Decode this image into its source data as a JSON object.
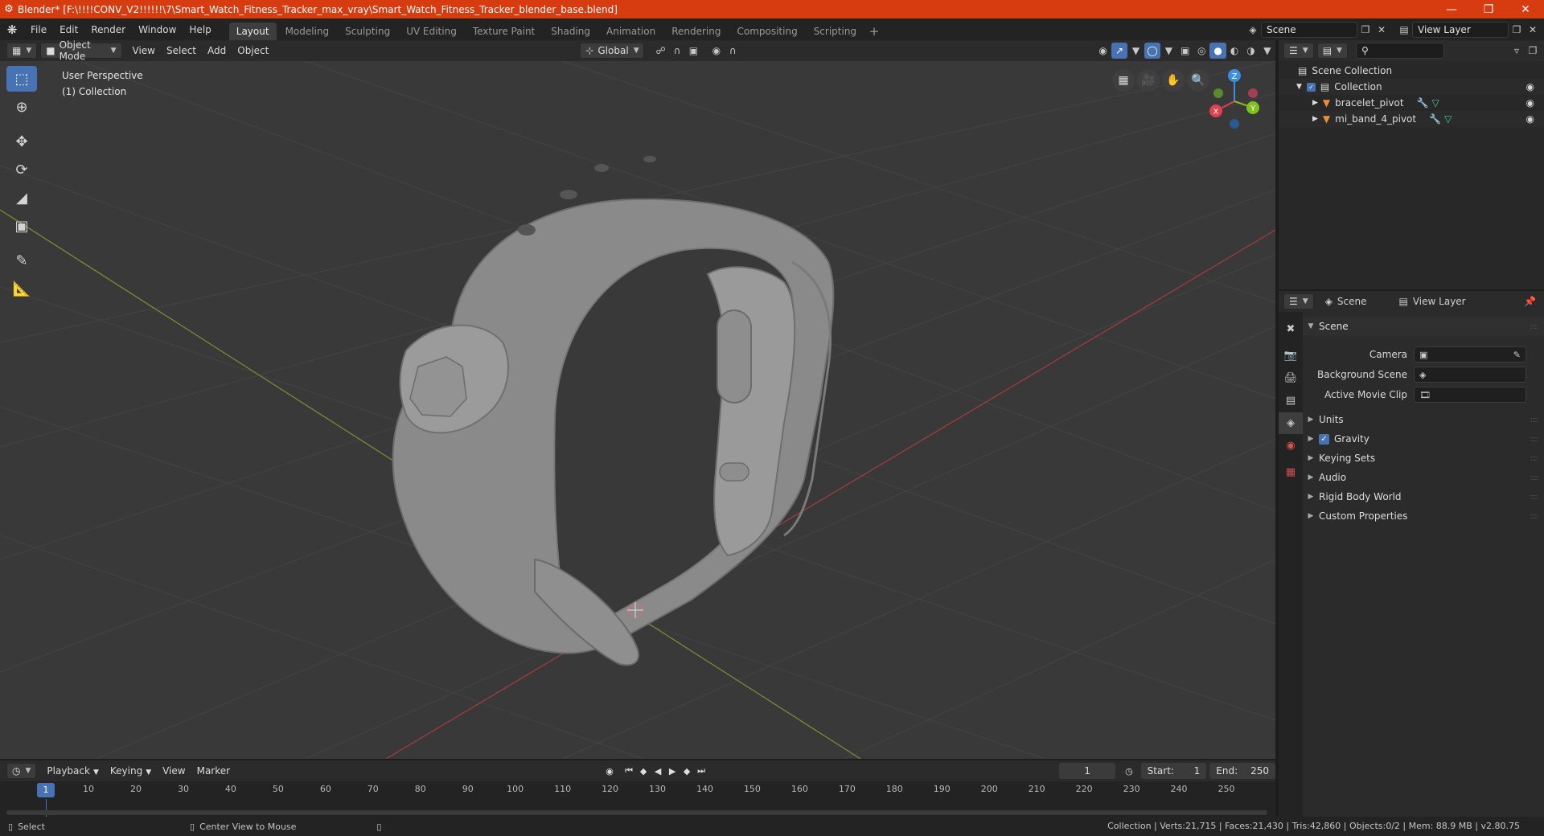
{
  "window": {
    "title": "Blender* [F:\\!!!!CONV_V2!!!!!!\\7\\Smart_Watch_Fitness_Tracker_max_vray\\Smart_Watch_Fitness_Tracker_blender_base.blend]",
    "minimize": "—",
    "maximize": "❐",
    "close": "✕"
  },
  "menu": {
    "file": "File",
    "edit": "Edit",
    "render": "Render",
    "window": "Window",
    "help": "Help"
  },
  "workspaces": [
    "Layout",
    "Modeling",
    "Sculpting",
    "UV Editing",
    "Texture Paint",
    "Shading",
    "Animation",
    "Rendering",
    "Compositing",
    "Scripting"
  ],
  "active_workspace": "Layout",
  "scene_selector": {
    "value": "Scene"
  },
  "view_layer_selector": {
    "value": "View Layer"
  },
  "viewport_header": {
    "mode": "Object Mode",
    "view": "View",
    "select": "Select",
    "add": "Add",
    "object": "Object",
    "orientation": "Global"
  },
  "viewport": {
    "perspective": "User Perspective",
    "collection": "(1) Collection",
    "gizmo": {
      "x": "X",
      "y": "Y",
      "z": "Z"
    }
  },
  "outliner": {
    "scene_collection": "Scene Collection",
    "collection": "Collection",
    "objects": [
      "bracelet_pivot",
      "mi_band_4_pivot"
    ]
  },
  "properties": {
    "tab_scene": "Scene",
    "tab_view_layer": "View Layer",
    "panel_title": "Scene",
    "fields": {
      "camera": "Camera",
      "background_scene": "Background Scene",
      "active_movie_clip": "Active Movie Clip"
    },
    "subpanels": [
      "Units",
      "Gravity",
      "Keying Sets",
      "Audio",
      "Rigid Body World",
      "Custom Properties"
    ],
    "gravity_checked": true
  },
  "timeline": {
    "playback": "Playback",
    "keying": "Keying",
    "view": "View",
    "marker": "Marker",
    "current_frame": "1",
    "start_label": "Start:",
    "start": "1",
    "end_label": "End:",
    "end": "250",
    "ticks": [
      1,
      10,
      20,
      30,
      40,
      50,
      60,
      70,
      80,
      90,
      100,
      110,
      120,
      130,
      140,
      150,
      160,
      170,
      180,
      190,
      200,
      210,
      220,
      230,
      240,
      250
    ]
  },
  "statusbar": {
    "select": "Select",
    "center_view": "Center View to Mouse",
    "stats": "Collection | Verts:21,715 | Faces:21,430 | Tris:42,860 | Objects:0/2 | Mem: 88.9 MB | v2.80.75"
  },
  "colors": {
    "title_bar": "#d63c10",
    "accent": "#4772b3",
    "viewport_bg": "#393939",
    "object_orange": "#e8903c"
  }
}
